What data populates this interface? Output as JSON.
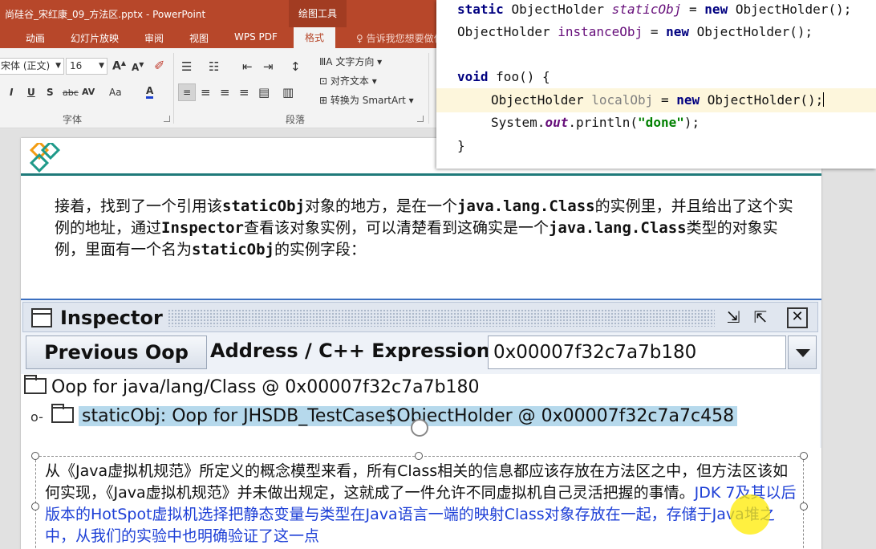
{
  "window": {
    "title": "尚硅谷_宋红康_09_方法区.pptx - PowerPoint",
    "context_tab": "绘图工具"
  },
  "ribbon_tabs": [
    {
      "label": "动画"
    },
    {
      "label": "幻灯片放映"
    },
    {
      "label": "审阅"
    },
    {
      "label": "视图"
    },
    {
      "label": "WPS PDF"
    },
    {
      "label": "格式",
      "active": true
    }
  ],
  "tell_me": "♀ 告诉我您想要做什么",
  "font_group": {
    "font_name": "宋体 (正文)",
    "font_size": "16",
    "grow": "A",
    "shrink": "A",
    "clear_format": "✐",
    "italic": "I",
    "underline": "U",
    "shadow": "S",
    "strike": "abc",
    "spacing": "AV",
    "case": "Aa",
    "color": "A",
    "label": "字体"
  },
  "paragraph_group": {
    "text_direction": "文字方向",
    "align_text": "对齐文本",
    "smartart": "转换为 SmartArt",
    "label": "段落"
  },
  "slide": {
    "para1_parts": [
      {
        "t": "接着，找到了一个引用该"
      },
      {
        "t": "staticObj",
        "mono": true
      },
      {
        "t": "对象的地方，是在一个"
      },
      {
        "t": "java.lang.Class",
        "mono": true
      },
      {
        "t": "的实例里，并且给出了这个实例的地址，通过"
      },
      {
        "t": "Inspector",
        "mono": true
      },
      {
        "t": "查看该对象实例，可以清楚看到这确实是一个"
      },
      {
        "t": "java.lang.Class",
        "mono": true
      },
      {
        "t": "类型的对象实例，里面有一个名为"
      },
      {
        "t": "staticObj",
        "mono": true
      },
      {
        "t": "的实例字段："
      }
    ],
    "inspector": {
      "title": "Inspector",
      "btn_minimize": "⇲",
      "btn_maximize": "⇱",
      "btn_close": "✕",
      "prev_button": "Previous Oop",
      "address_label": "Address / C++ Expression:",
      "address_value": "0x00007f32c7a7b180",
      "tree_root": "Oop for java/lang/Class @ 0x00007f32c7a7b180",
      "tree_child": "staticObj: Oop for JHSDB_TestCase$ObjectHolder @ 0x00007f32c7a7c458",
      "twist": "o-"
    },
    "para2_black": "从《Java虚拟机规范》所定义的概念模型来看，所有Class相关的信息都应该存放在方法区之中，但方法区该如何实现，《Java虚拟机规范》并未做出规定，这就成了一件允许不同虚拟机自己灵活把握的事情。",
    "para2_blue": "JDK 7及其以后版本的HotSpot虚拟机选择把静态变量与类型在Java语言一端的映射Class对象存放在一起，存储于Java堆之中，从我们的实验中也明确验证了这一点"
  },
  "code": {
    "line1": {
      "kw": "static",
      "type": "ObjectHolder",
      "name": "staticObj",
      "eq": "=",
      "kw2": "new",
      "ctor": "ObjectHolder();"
    },
    "line2": {
      "type": "ObjectHolder",
      "name": "instanceObj",
      "eq": "=",
      "kw2": "new",
      "ctor": "ObjectHolder();"
    },
    "line3": {
      "kw": "void",
      "rest": "foo() {"
    },
    "line4": {
      "type": "ObjectHolder",
      "name": "localObj",
      "eq": "=",
      "kw2": "new",
      "ctor": "ObjectHolder();"
    },
    "line5": {
      "pre": "System.",
      "field": "out",
      "mid": ".println(",
      "str": "\"done\"",
      "post": ");"
    },
    "line6": "}"
  }
}
